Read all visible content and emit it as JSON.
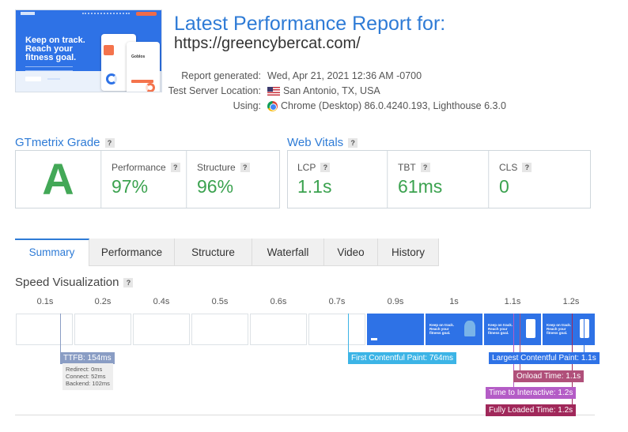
{
  "thumbnail": {
    "headline": "Keep on track. Reach your fitness goal.",
    "card_title": "Goblos",
    "frame_headline": "Keep on track. Reach your fitness goal."
  },
  "header": {
    "title": "Latest Performance Report for:",
    "url": "https://greencybercat.com/",
    "report_generated_label": "Report generated:",
    "report_generated_value": "Wed, Apr 21, 2021 12:36 AM -0700",
    "server_label": "Test Server Location:",
    "server_value": "San Antonio, TX, USA",
    "using_label": "Using:",
    "using_value": "Chrome (Desktop) 86.0.4240.193, Lighthouse 6.3.0"
  },
  "grade": {
    "heading": "GTmetrix Grade",
    "help": "?",
    "letter": "A",
    "performance_label": "Performance",
    "performance_value": "97%",
    "structure_label": "Structure",
    "structure_value": "96%"
  },
  "vitals": {
    "heading": "Web Vitals",
    "help": "?",
    "lcp_label": "LCP",
    "lcp_value": "1.1s",
    "tbt_label": "TBT",
    "tbt_value": "61ms",
    "cls_label": "CLS",
    "cls_value": "0"
  },
  "tabs": [
    "Summary",
    "Performance",
    "Structure",
    "Waterfall",
    "Video",
    "History"
  ],
  "active_tab": "Summary",
  "speed": {
    "heading": "Speed Visualization",
    "help": "?",
    "ticks": [
      "0.1s",
      "0.2s",
      "0.4s",
      "0.5s",
      "0.6s",
      "0.7s",
      "0.9s",
      "1s",
      "1.1s",
      "1.2s"
    ],
    "ttfb": "TTFB: 154ms",
    "redirect": "Redirect: 0ms",
    "connect": "Connect: 52ms",
    "backend": "Backend: 102ms",
    "fcp": "First Contentful Paint: 764ms",
    "lcp": "Largest Contentful Paint: 1.1s",
    "onload": "Onload Time: 1.1s",
    "tti": "Time to Interactive: 1.2s",
    "fully_loaded": "Fully Loaded Time: 1.2s"
  },
  "colors": {
    "accent": "#2e7bd6",
    "grade_green": "#43a857",
    "ttfb": "#8a9dc4",
    "fcp": "#3cb4e6",
    "lcp": "#2e72e6",
    "onload": "#b0507a",
    "tti": "#b45cc6",
    "fully_loaded": "#a0285a"
  }
}
